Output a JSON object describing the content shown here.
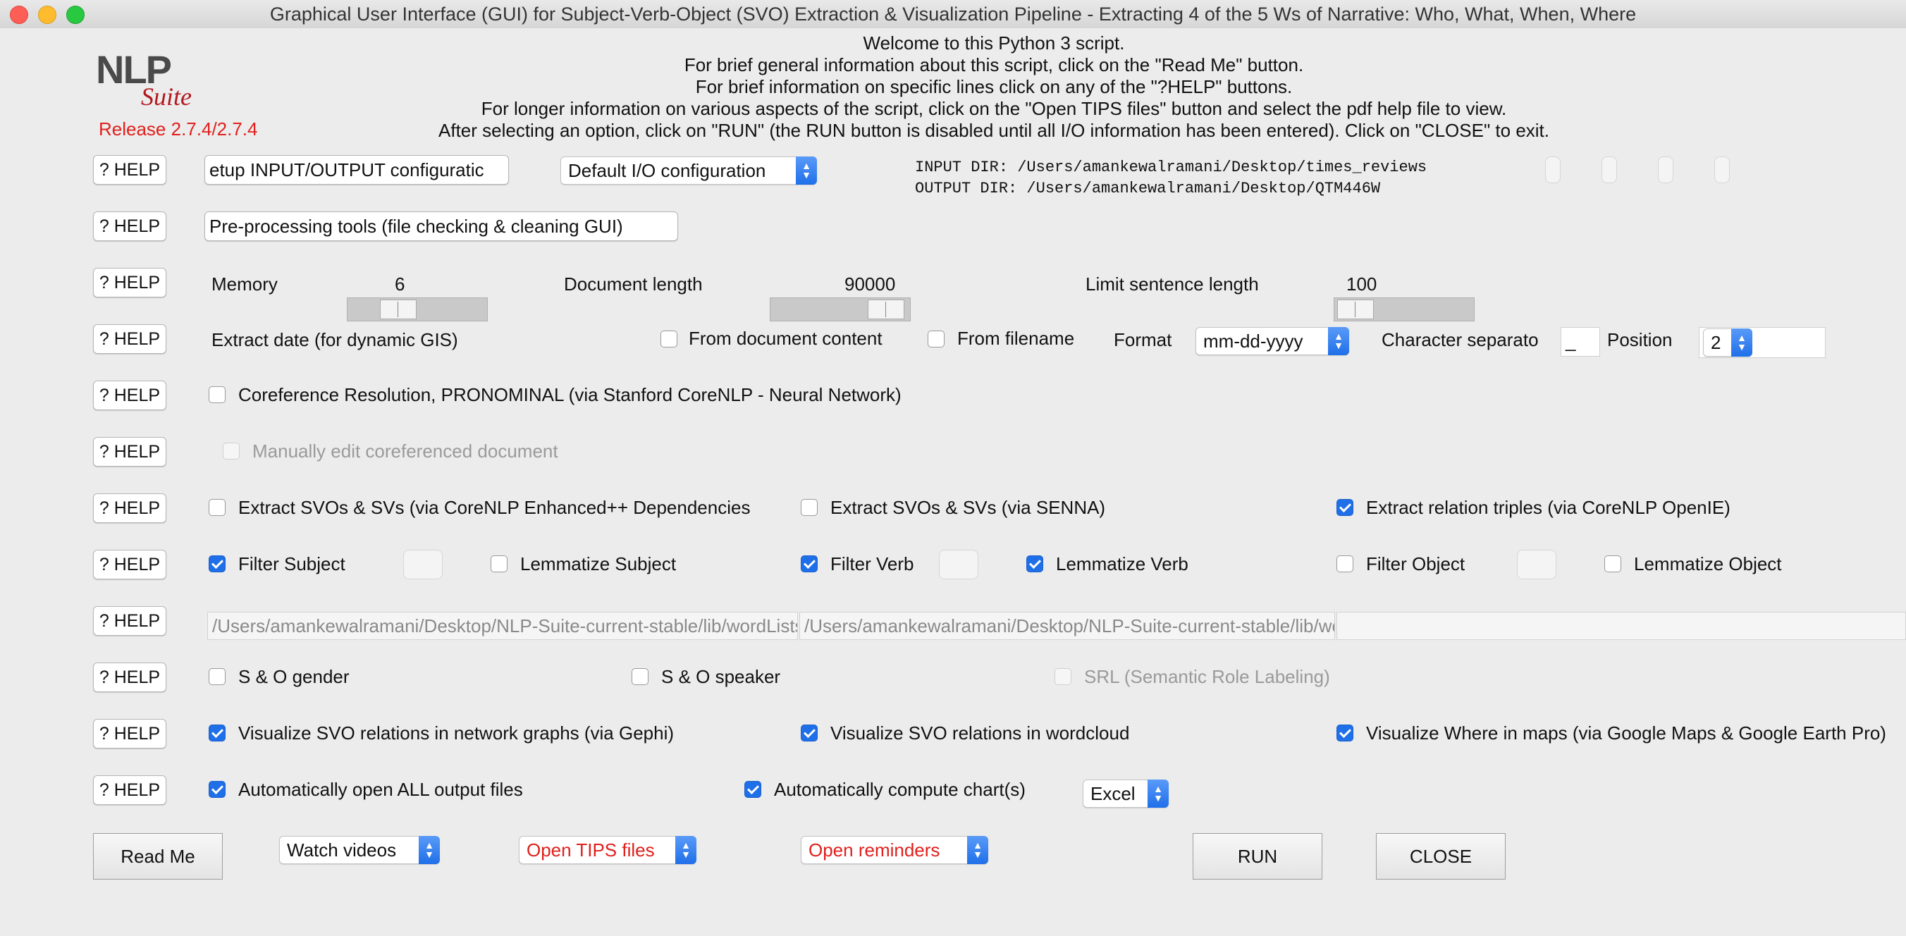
{
  "window": {
    "title": "Graphical User Interface (GUI) for Subject-Verb-Object (SVO) Extraction & Visualization Pipeline - Extracting 4 of the 5 Ws of Narrative: Who, What, When, Where"
  },
  "logo": {
    "nlp": "NLP",
    "suite": "Suite"
  },
  "release": "Release 2.7.4/2.7.4",
  "welcome": [
    "Welcome to this Python 3 script.",
    "For brief general information about this script, click on the \"Read Me\" button.",
    "For brief information on specific lines click on any of the \"?HELP\" buttons.",
    "For longer information on various aspects of the script, click on the \"Open TIPS files\" button and select the pdf help file to view.",
    "After selecting an option, click on \"RUN\" (the RUN button is disabled until all I/O information has been entered).   Click on \"CLOSE\" to exit."
  ],
  "help_label": "? HELP",
  "io": {
    "setup_button": "etup INPUT/OUTPUT configuratic",
    "config_select": "Default I/O configuration",
    "input_dir": "INPUT DIR: /Users/amankewalramani/Desktop/times_reviews",
    "output_dir": "OUTPUT DIR: /Users/amankewalramani/Desktop/QTM446W"
  },
  "preprocessing_button": "Pre-processing tools (file checking & cleaning GUI)",
  "sliders": {
    "memory_label": "Memory",
    "memory_value": "6",
    "doclen_label": "Document length",
    "doclen_value": "90000",
    "sentlen_label": "Limit sentence length",
    "sentlen_value": "100"
  },
  "date": {
    "label": "Extract date (for dynamic GIS)",
    "from_content": "From document content",
    "from_filename": "From filename",
    "format_label": "Format",
    "format_value": "mm-dd-yyyy",
    "separator_label": "Character separato",
    "separator_value": "_",
    "position_label": "Position",
    "position_value": "2"
  },
  "coref": {
    "label": "Coreference Resolution, PRONOMINAL (via Stanford CoreNLP - Neural Network)",
    "manual_edit": "Manually edit coreferenced document"
  },
  "extract": {
    "corenlp_enhanced": "Extract SVOs & SVs (via CoreNLP Enhanced++ Dependencies",
    "senna": "Extract SVOs & SVs (via SENNA)",
    "openie": "Extract relation triples (via CoreNLP OpenIE)"
  },
  "filters": {
    "filter_subject": "Filter Subject",
    "lemmatize_subject": "Lemmatize Subject",
    "filter_verb": "Filter Verb",
    "lemmatize_verb": "Lemmatize Verb",
    "filter_object": "Filter Object",
    "lemmatize_object": "Lemmatize Object"
  },
  "paths": {
    "path1": "/Users/amankewalramani/Desktop/NLP-Suite-current-stable/lib/wordLists/",
    "path2": "/Users/amankewalramani/Desktop/NLP-Suite-current-stable/lib/wordLists/",
    "path3": ""
  },
  "so": {
    "gender": "S & O gender",
    "speaker": "S & O speaker",
    "srl": "SRL (Semantic Role Labeling)"
  },
  "visualize": {
    "gephi": "Visualize SVO relations in network graphs (via Gephi)",
    "wordcloud": "Visualize SVO relations in wordcloud",
    "maps": "Visualize Where in maps (via Google Maps & Google Earth Pro)"
  },
  "output": {
    "open_all": "Automatically open ALL output files",
    "compute_charts": "Automatically compute chart(s)",
    "chart_package": "Excel"
  },
  "bottom": {
    "read_me": "Read Me",
    "watch_videos": "Watch videos",
    "open_tips": "Open TIPS files",
    "open_reminders": "Open reminders",
    "run": "RUN",
    "close": "CLOSE"
  },
  "colors": {
    "accent": "#1f6fe9",
    "red": "#e0201d"
  }
}
